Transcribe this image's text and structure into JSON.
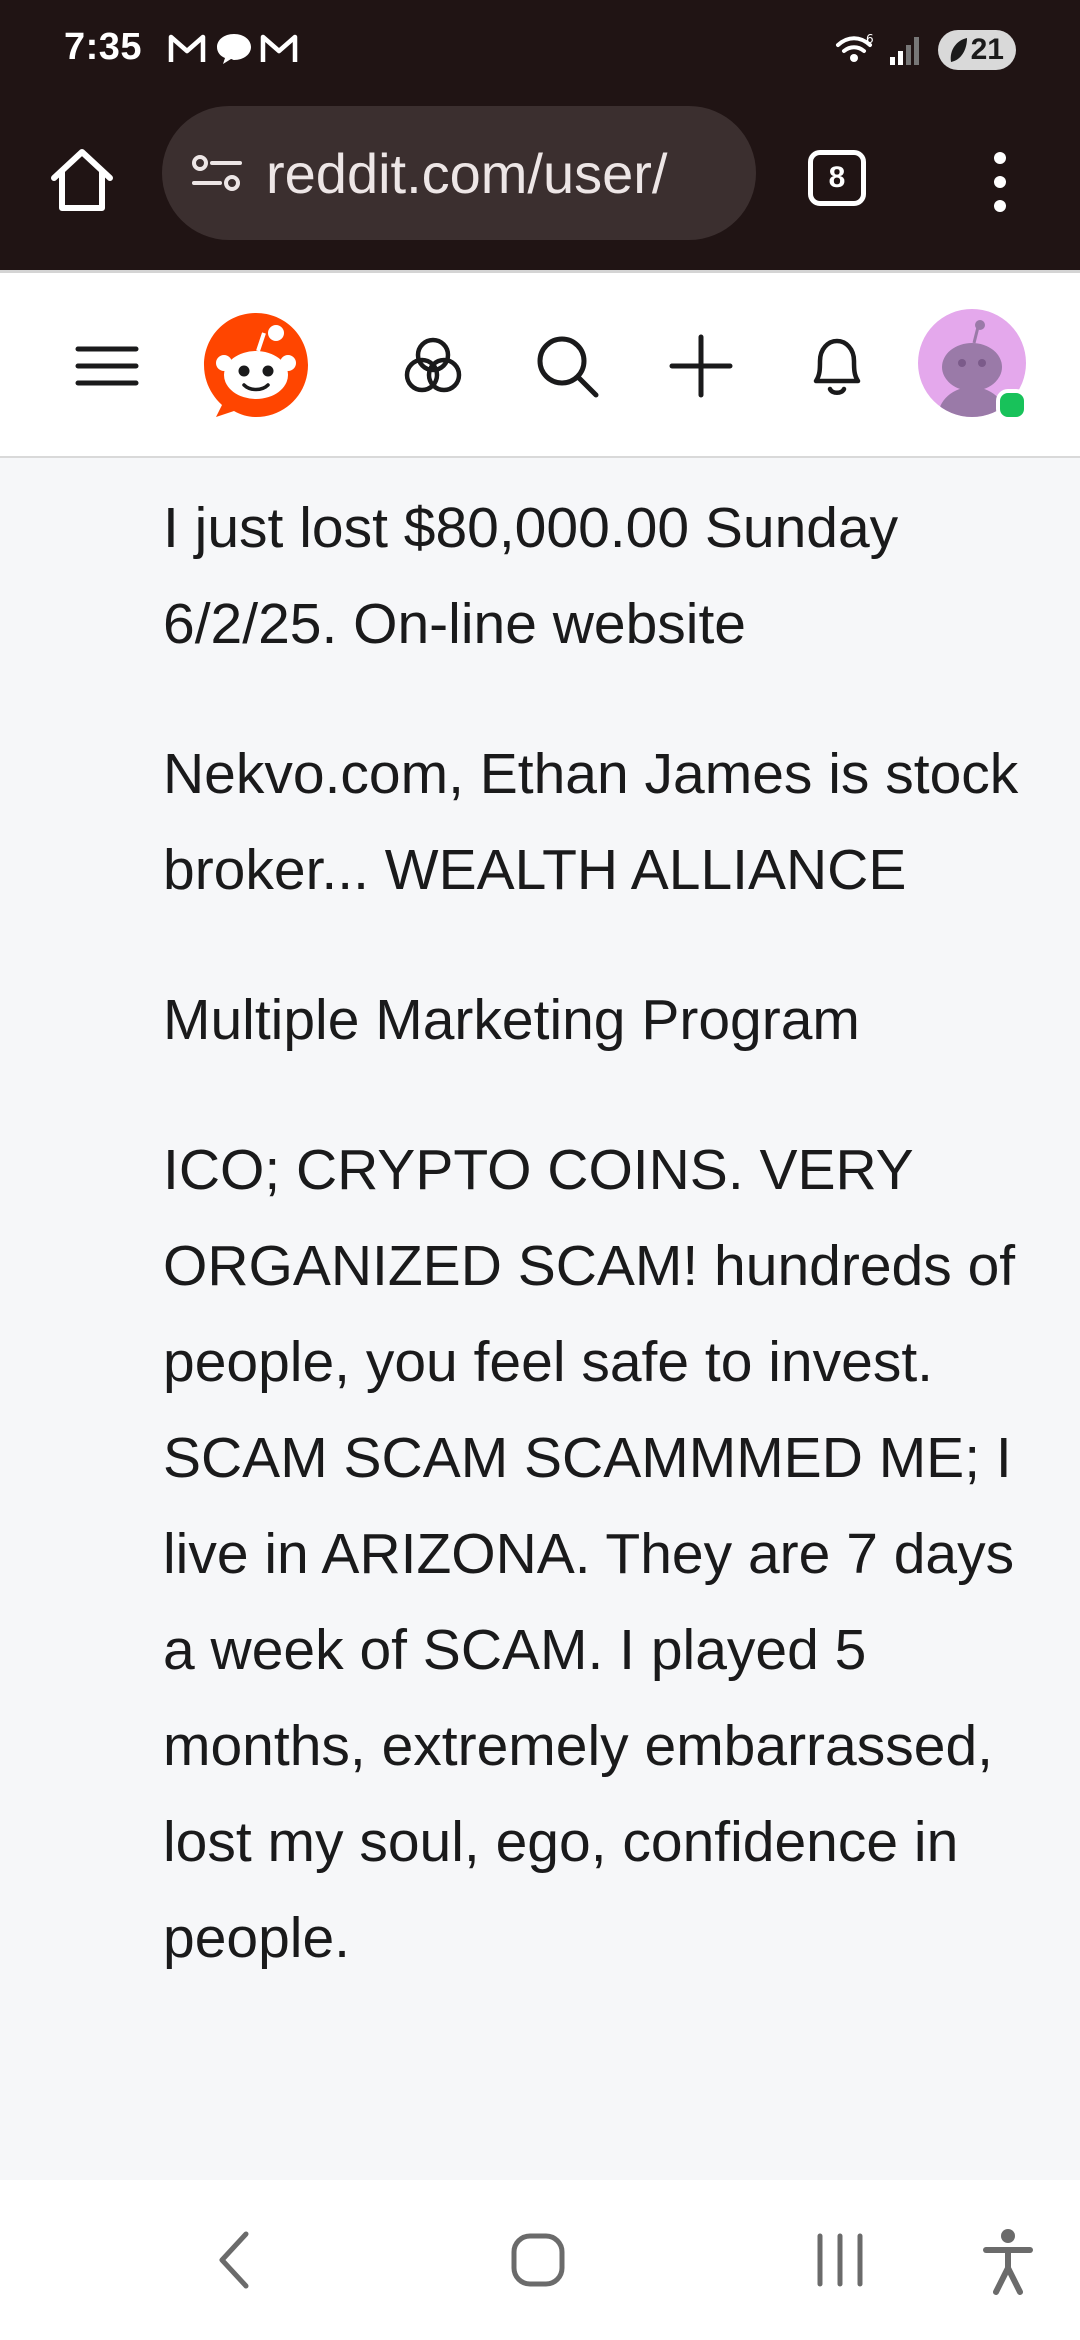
{
  "status_bar": {
    "time": "7:35",
    "notifications": [
      "gmail-icon",
      "chat-icon",
      "gmail-icon"
    ],
    "battery": "21",
    "wifi_label": "6"
  },
  "browser": {
    "url": "reddit.com/user/",
    "tab_count": "8"
  },
  "post": {
    "paragraphs": [
      "I just lost $80,000.00 Sunday 6/2/25. On-line website",
      "Nekvo.com, Ethan James is stock broker... WEALTH ALLIANCE",
      "Multiple Marketing Program",
      "ICO; CRYPTO COINS. VERY ORGANIZED SCAM! hundreds of people, you feel safe to invest. SCAM SCAM SCAMMMED ME; I live in ARIZONA. They are 7 days a week of SCAM.  I played 5 months, extremely embarrassed, lost my soul, ego, confidence in people."
    ]
  },
  "colors": {
    "chrome_bg": "#201414",
    "url_box": "#3b2f2f",
    "reddit_orange": "#ff4500",
    "online": "#18c25a"
  }
}
